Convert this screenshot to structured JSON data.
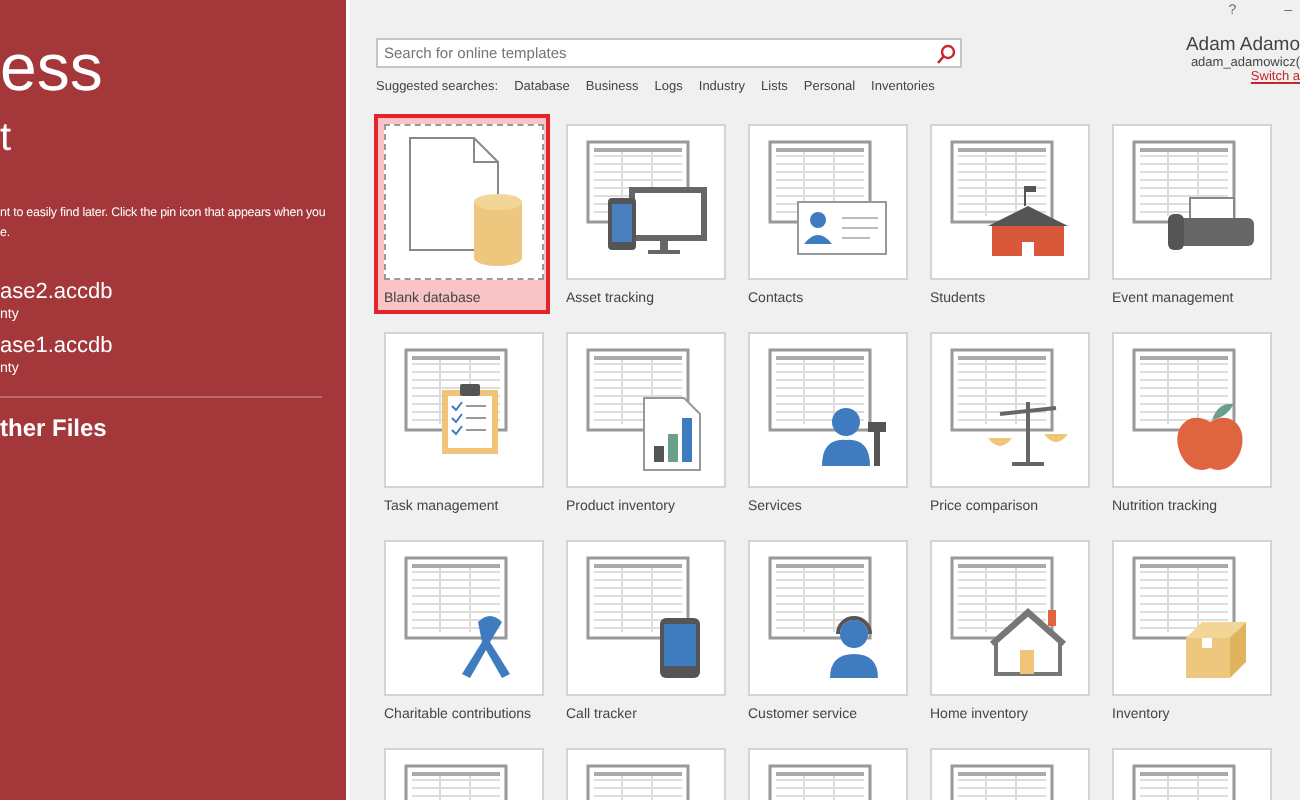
{
  "sidebar": {
    "app_title": "ess",
    "section_title": "t",
    "hint": "nt to easily find later. Click the pin icon that appears when you\ne.",
    "recent_files": [
      {
        "name": "ase2.accdb",
        "location": "nty"
      },
      {
        "name": "ase1.accdb",
        "location": "nty"
      }
    ],
    "open_other": "ther Files"
  },
  "window_controls": [
    "?",
    "–"
  ],
  "search": {
    "placeholder": "Search for online templates"
  },
  "suggested": {
    "label": "Suggested searches:",
    "links": [
      "Database",
      "Business",
      "Logs",
      "Industry",
      "Lists",
      "Personal",
      "Inventories"
    ]
  },
  "account": {
    "name": "Adam Adamo",
    "email": "adam_adamowicz(",
    "switch": "Switch a"
  },
  "templates": [
    {
      "label": "Blank database",
      "kind": "blank",
      "selected": true
    },
    {
      "label": "Asset tracking",
      "kind": "devices",
      "selected": false
    },
    {
      "label": "Contacts",
      "kind": "contact",
      "selected": false
    },
    {
      "label": "Students",
      "kind": "school",
      "selected": false
    },
    {
      "label": "Event management",
      "kind": "printer",
      "selected": false
    },
    {
      "label": "Task management",
      "kind": "clipboard",
      "selected": false
    },
    {
      "label": "Product inventory",
      "kind": "chart",
      "selected": false
    },
    {
      "label": "Services",
      "kind": "technician",
      "selected": false
    },
    {
      "label": "Price comparison",
      "kind": "scale",
      "selected": false
    },
    {
      "label": "Nutrition tracking",
      "kind": "apple",
      "selected": false
    },
    {
      "label": "Charitable contributions",
      "kind": "ribbon",
      "selected": false
    },
    {
      "label": "Call tracker",
      "kind": "phone",
      "selected": false
    },
    {
      "label": "Customer service",
      "kind": "headset",
      "selected": false
    },
    {
      "label": "Home inventory",
      "kind": "house",
      "selected": false
    },
    {
      "label": "Inventory",
      "kind": "box",
      "selected": false
    },
    {
      "kind": "sheet",
      "selected": false
    },
    {
      "kind": "sheet",
      "selected": false
    },
    {
      "kind": "sheet",
      "selected": false
    },
    {
      "kind": "sheet",
      "selected": false
    },
    {
      "kind": "sheet",
      "selected": false
    }
  ]
}
